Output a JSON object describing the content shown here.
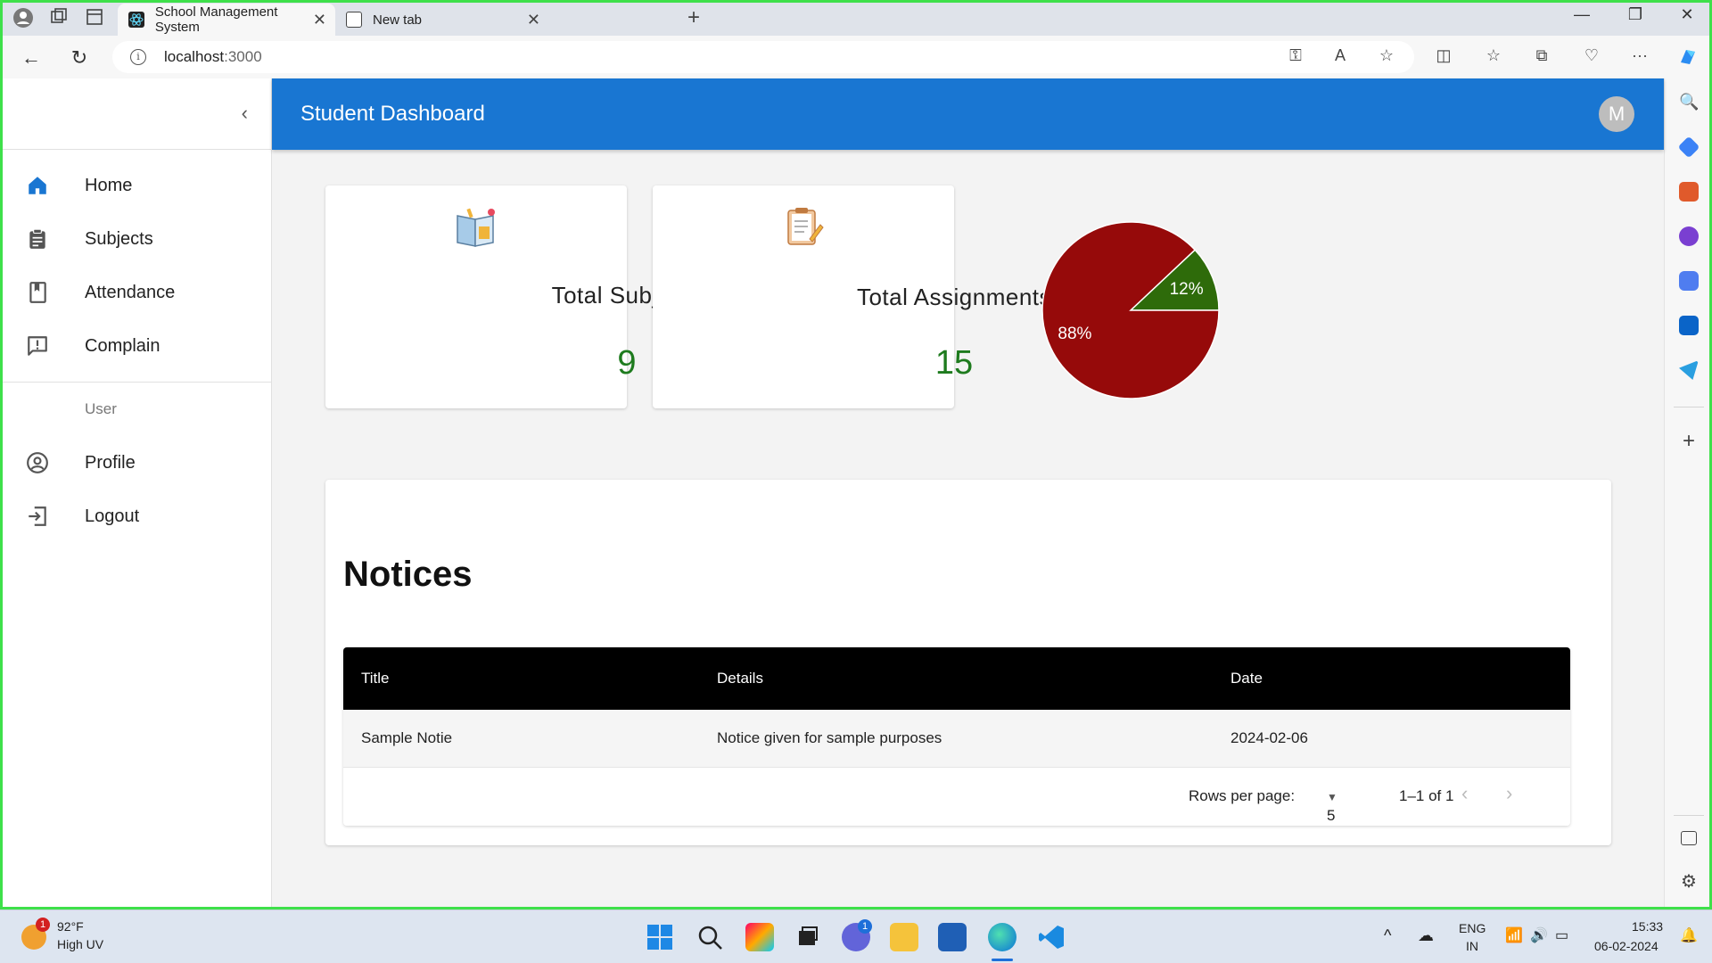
{
  "browser": {
    "tabs": [
      {
        "title": "School Management System",
        "active": true
      },
      {
        "title": "New tab",
        "active": false
      }
    ],
    "url_host": "localhost",
    "url_port": ":3000"
  },
  "drawer": {
    "items": [
      {
        "label": "Home",
        "icon": "home-icon",
        "active": true
      },
      {
        "label": "Subjects",
        "icon": "clipboard-icon"
      },
      {
        "label": "Attendance",
        "icon": "bookmark-book-icon"
      },
      {
        "label": "Complain",
        "icon": "feedback-icon"
      }
    ],
    "user_header": "User",
    "user_items": [
      {
        "label": "Profile",
        "icon": "account-circle-icon"
      },
      {
        "label": "Logout",
        "icon": "logout-icon"
      }
    ]
  },
  "header": {
    "title": "Student Dashboard",
    "avatar_initial": "M"
  },
  "stats": {
    "subjects": {
      "label": "Total Subjects",
      "value": "9"
    },
    "assignments": {
      "label": "Total Assignments",
      "value": "15"
    }
  },
  "chart_data": {
    "type": "pie",
    "slices": [
      {
        "label": "88%",
        "value": 88,
        "color": "#960a0a"
      },
      {
        "label": "12%",
        "value": 12,
        "color": "#2e6b0a"
      }
    ]
  },
  "notices": {
    "title": "Notices",
    "columns": [
      "Title",
      "Details",
      "Date"
    ],
    "rows": [
      {
        "title": "Sample Notie",
        "details": "Notice given for sample purposes",
        "date": "2024-02-06"
      }
    ],
    "rows_per_page_label": "Rows per page:",
    "rows_per_page": "5",
    "range": "1–1 of 1"
  },
  "taskbar": {
    "weather_temp": "92°F",
    "weather_desc": "High UV",
    "weather_badge": "1",
    "lang_top": "ENG",
    "lang_bottom": "IN",
    "time": "15:33",
    "date": "06-02-2024",
    "chat_badge": "1"
  },
  "colors": {
    "primary": "#1976d2",
    "stat_value": "#1e7b1e"
  }
}
